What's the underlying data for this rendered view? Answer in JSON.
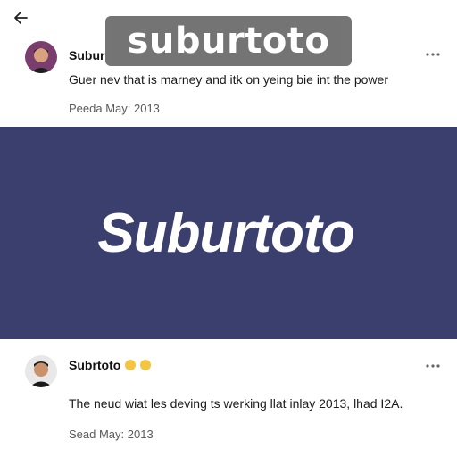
{
  "overlay": {
    "title": "suburtoto"
  },
  "post1": {
    "username": "Subur",
    "text": "Guer nev that is marney and itk on yeing bie int the power",
    "date": "Peeda May: 2013"
  },
  "banner": {
    "logo_text": "Suburtoto",
    "background": "#3b3f6e"
  },
  "post2": {
    "username": "Subrtoto",
    "emojis": [
      "grinning-face-emoji",
      "grinning-face-emoji"
    ],
    "text": "The neud wiat les deving ts werking llat inlay 2013, lhad I2A.",
    "date": "Sead May: 2013"
  },
  "icons": {
    "back": "back-arrow-icon",
    "more": "more-options-icon"
  }
}
